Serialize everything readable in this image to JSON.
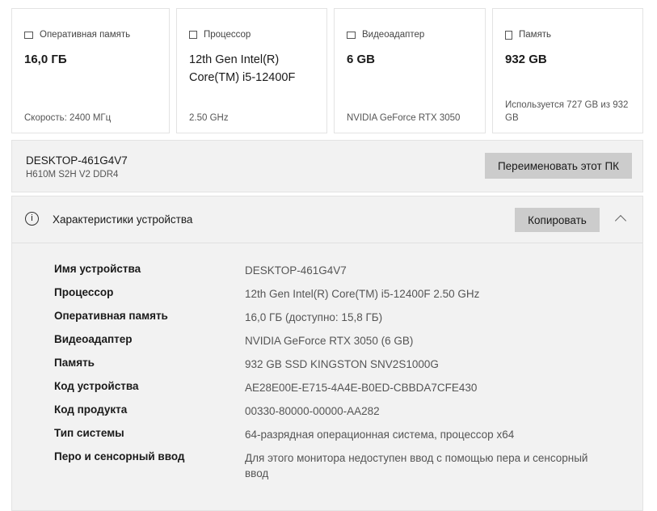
{
  "cards": [
    {
      "icon": "ram-icon",
      "label": "Оперативная память",
      "value": "16,0 ГБ",
      "sub": "Скорость: 2400 МГц"
    },
    {
      "icon": "cpu-icon",
      "label": "Процессор",
      "value": "12th Gen Intel(R) Core(TM) i5-12400F",
      "sub": "2.50 GHz"
    },
    {
      "icon": "gpu-icon",
      "label": "Видеоадаптер",
      "value": "6 GB",
      "sub": "NVIDIA GeForce RTX 3050"
    },
    {
      "icon": "storage-icon",
      "label": "Память",
      "value": "932 GB",
      "sub": "Используется 727 GB из 932 GB"
    }
  ],
  "pc": {
    "name": "DESKTOP-461G4V7",
    "model": "H610M S2H V2 DDR4",
    "rename_label": "Переименовать этот ПК"
  },
  "specs": {
    "title": "Характеристики устройства",
    "copy_label": "Копировать",
    "info_glyph": "i",
    "rows": [
      {
        "k": "Имя устройства",
        "v": "DESKTOP-461G4V7"
      },
      {
        "k": "Процессор",
        "v": "12th Gen Intel(R) Core(TM) i5-12400F   2.50 GHz"
      },
      {
        "k": "Оперативная память",
        "v": "16,0 ГБ (доступно: 15,8 ГБ)"
      },
      {
        "k": "Видеоадаптер",
        "v": "NVIDIA GeForce RTX 3050 (6 GB)"
      },
      {
        "k": "Память",
        "v": "932 GB SSD KINGSTON SNV2S1000G"
      },
      {
        "k": "Код устройства",
        "v": "AE28E00E-E715-4A4E-B0ED-CBBDA7CFE430"
      },
      {
        "k": "Код продукта",
        "v": "00330-80000-00000-AA282"
      },
      {
        "k": "Тип системы",
        "v": "64-разрядная операционная система, процессор x64"
      },
      {
        "k": "Перо и сенсорный ввод",
        "v": "Для этого монитора недоступен ввод с помощью пера и сенсорный ввод"
      }
    ]
  }
}
